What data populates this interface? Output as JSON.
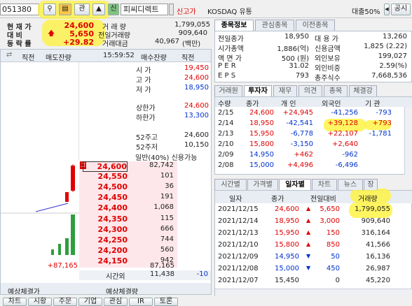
{
  "toolbar": {
    "code": "051380",
    "search_icon": "search-icon",
    "gwan_label": "관",
    "sin_label": "신",
    "name": "피씨디렉트",
    "new_high": "신고가",
    "market": "KOSDAQ 유통",
    "loan_ratio": "대출50%",
    "notice_label": "공시"
  },
  "quote": {
    "label_price": "현 재 가",
    "label_change": "대 비",
    "label_rate": "등 락 률",
    "price": "24,600",
    "change": "5,650",
    "rate": "+29.82",
    "label_volume": "거 래 량",
    "label_prev_ratio": "전일거래량",
    "label_value": "거래대금",
    "volume": "1,799,055",
    "prev_volume": "909,640",
    "value": "40,967",
    "value_unit": "(백만)"
  },
  "orderbook": {
    "h_prev": "직전",
    "h_sell": "매도잔량",
    "time": "15:59:52",
    "h_buy": "매수잔량",
    "h_prev2": "직전",
    "summary_labels": [
      "시 가",
      "고 가",
      "저 가",
      "상한가",
      "하한가",
      "52주고",
      "52주저"
    ],
    "summary_values": [
      "19,450",
      "24,600",
      "18,950",
      "24,600",
      "13,300",
      "24,600",
      "10,150"
    ],
    "credit_line": "일반(40%) 신용가능",
    "sell_prices": [
      {
        "mark": "고",
        "price": "24,600",
        "qty": "82,742"
      },
      {
        "price": "24,550",
        "qty": "101"
      },
      {
        "price": "24,500",
        "qty": "36"
      },
      {
        "price": "24,450",
        "qty": "191"
      },
      {
        "price": "24,400",
        "qty": "1,068"
      }
    ],
    "buy_prices": [
      {
        "price": "24,350",
        "qty": "115"
      },
      {
        "price": "24,300",
        "qty": "666"
      },
      {
        "price": "24,250",
        "qty": "744"
      },
      {
        "price": "24,200",
        "qty": "560"
      },
      {
        "price": "24,150",
        "qty": "942"
      }
    ],
    "net_left": "+87,165",
    "total_buy": "87,165",
    "after_label": "시간외",
    "after_qty": "11,438",
    "after_change": "-10",
    "expect_label": "예상체결가",
    "expect_qty_label": "예상체결량"
  },
  "info": {
    "tabs": [
      "종목정보",
      "관심종목",
      "이전종목"
    ],
    "rows": [
      {
        "l1": "전일종가",
        "v1": "18,950",
        "l2": "대 용 가",
        "v2": "13,260"
      },
      {
        "l1": "시가총액",
        "v1": "1,886(억)",
        "l2": "신용금액",
        "v2": "1,825 (2.22)"
      },
      {
        "l1": "액 면 가",
        "v1": "500 (원)",
        "l2": "외인보유",
        "v2": "199,027"
      },
      {
        "l1": "P E R",
        "v1": "31.02",
        "l2": "외인비중",
        "v2": "2.59(%)"
      },
      {
        "l1": "E P S",
        "v1": "793",
        "l2": "총주식수",
        "v2": "7,668,536"
      }
    ]
  },
  "investor": {
    "tabs": [
      "거래원",
      "투자자",
      "재무",
      "의견",
      "종목",
      "체결강"
    ],
    "headers": [
      "수량",
      "종가",
      "개 인",
      "외국인",
      "기 관"
    ],
    "rows": [
      {
        "d": "2/15",
        "p": "24,600",
        "a": "+24,945",
        "f": "-41,256",
        "i": "-793"
      },
      {
        "d": "2/14",
        "p": "18,950",
        "a": "-42,541",
        "f": "+39,128",
        "i": "+793"
      },
      {
        "d": "2/13",
        "p": "15,950",
        "a": "-6,778",
        "f": "+22,107",
        "i": "-1,781"
      },
      {
        "d": "2/10",
        "p": "15,800",
        "a": "-3,150",
        "f": "+2,640",
        "i": ""
      },
      {
        "d": "2/09",
        "p": "14,950",
        "a": "+462",
        "f": "-962",
        "i": ""
      },
      {
        "d": "2/08",
        "p": "15,000",
        "a": "+4,496",
        "f": "-6,496",
        "i": ""
      }
    ]
  },
  "daily": {
    "tabs": [
      "시간별",
      "가격별",
      "일자별",
      "차트",
      "뉴스",
      "장"
    ],
    "headers": [
      "일자",
      "종가",
      "전일대비",
      "거래량"
    ],
    "rows": [
      {
        "d": "2021/12/15",
        "p": "24,600",
        "c": "5,650",
        "dir": "up",
        "v": "1,799,055"
      },
      {
        "d": "2021/12/14",
        "p": "18,950",
        "c": "3,000",
        "dir": "up",
        "v": "909,640"
      },
      {
        "d": "2021/12/13",
        "p": "15,950",
        "c": "150",
        "dir": "up",
        "v": "316,164"
      },
      {
        "d": "2021/12/10",
        "p": "15,800",
        "c": "850",
        "dir": "up",
        "v": "41,566"
      },
      {
        "d": "2021/12/09",
        "p": "14,950",
        "c": "50",
        "dir": "down",
        "v": "16,136"
      },
      {
        "d": "2021/12/08",
        "p": "15,000",
        "c": "450",
        "dir": "down",
        "v": "26,987"
      },
      {
        "d": "2021/12/07",
        "p": "15,450",
        "c": "0",
        "dir": "flat",
        "v": "45,220"
      }
    ]
  },
  "bottom_tabs": [
    "차트",
    "시황",
    "주문",
    "기업",
    "관심",
    "IR",
    "토론"
  ],
  "colors": {
    "up": "#e00000",
    "down": "#0033cc",
    "highlight": "#fff23a"
  }
}
